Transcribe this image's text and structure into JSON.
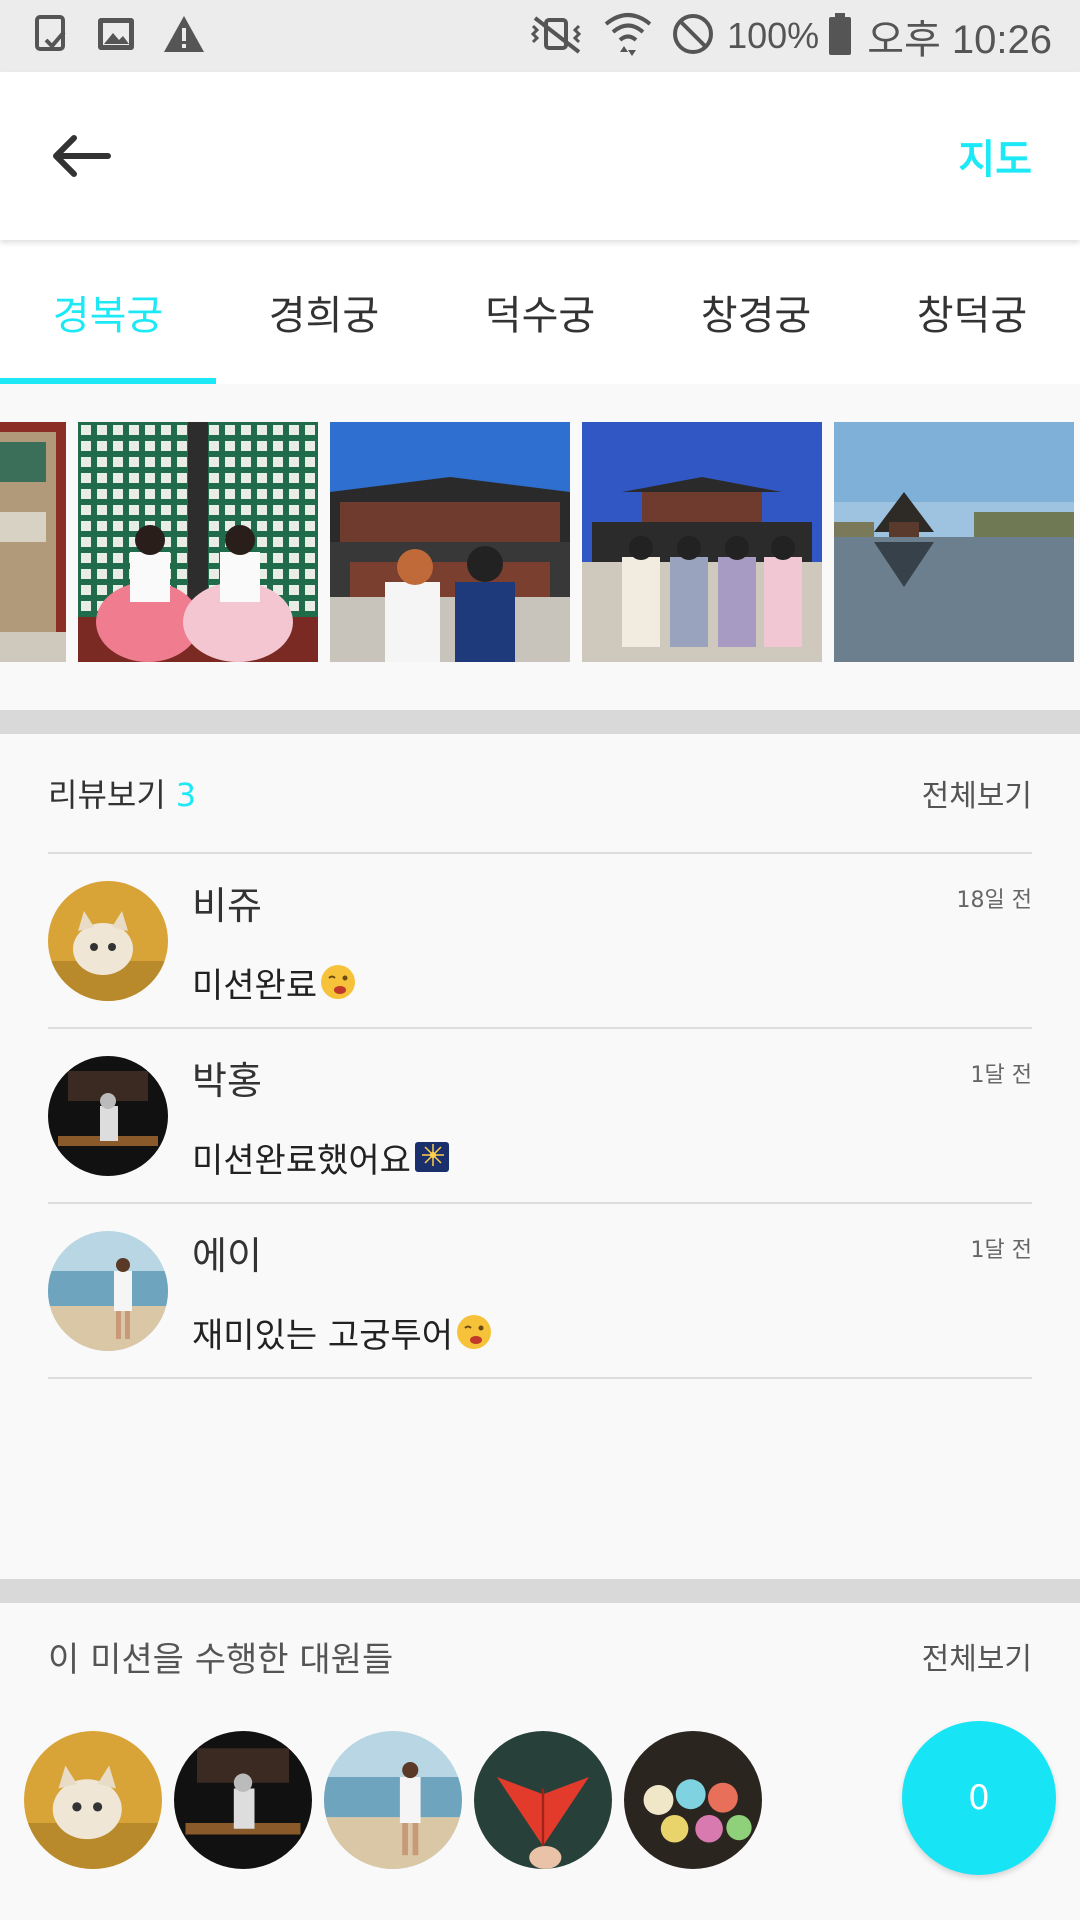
{
  "status_bar": {
    "battery": "100%",
    "time": "오후 10:26"
  },
  "header": {
    "map_label": "지도"
  },
  "tabs": [
    {
      "label": "경복궁",
      "active": true
    },
    {
      "label": "경희궁",
      "active": false
    },
    {
      "label": "덕수궁",
      "active": false
    },
    {
      "label": "창경궁",
      "active": false
    },
    {
      "label": "창덕궁",
      "active": false
    }
  ],
  "reviews_section": {
    "title": "리뷰보기",
    "count": "3",
    "see_all": "전체보기",
    "items": [
      {
        "name": "비쥬",
        "text": "미션완료",
        "time": "18일 전"
      },
      {
        "name": "박홍",
        "text": "미션완료했어요",
        "time": "1달 전"
      },
      {
        "name": "에이",
        "text": "재미있는 고궁투어",
        "time": "1달 전"
      }
    ]
  },
  "members_section": {
    "title": "이 미션을 수행한 대원들",
    "see_all": "전체보기",
    "fab_count": "0"
  },
  "colors": {
    "accent": "#1de9f6"
  }
}
